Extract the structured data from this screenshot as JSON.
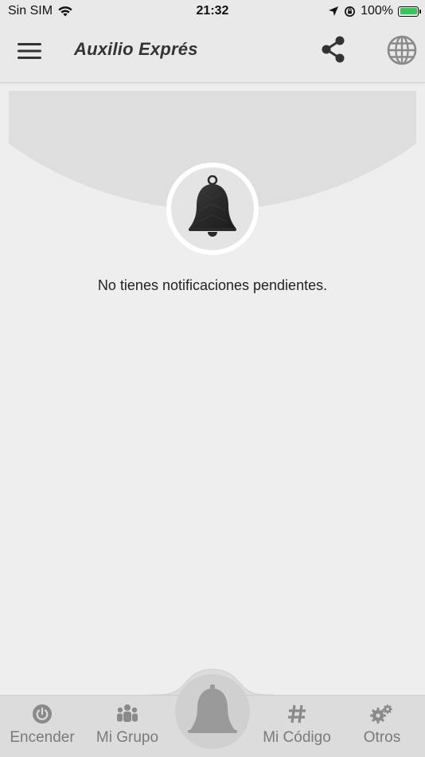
{
  "status_bar": {
    "carrier": "Sin SIM",
    "time": "21:32",
    "battery": "100%",
    "battery_color": "#34c759"
  },
  "app_bar": {
    "title": "Auxilio Exprés",
    "icons": [
      "menu-icon",
      "share-icon",
      "globe-icon"
    ]
  },
  "notifications": {
    "header_icon": "bell-icon",
    "empty_message": "No tienes notificaciones pendientes."
  },
  "bottom_nav": {
    "items": [
      {
        "label": "Encender",
        "icon": "power-icon"
      },
      {
        "label": "Mi Grupo",
        "icon": "group-icon"
      },
      {
        "label": "Mi Código",
        "icon": "hashtag-icon"
      },
      {
        "label": "Otros",
        "icon": "gears-icon"
      }
    ],
    "center_icon": "bell-icon"
  },
  "colors": {
    "background": "#eeeeee",
    "bar": "#e9e9e9",
    "nav": "#dcdcdc",
    "icon_dark": "#333333",
    "icon_muted": "#8a8a8a"
  }
}
